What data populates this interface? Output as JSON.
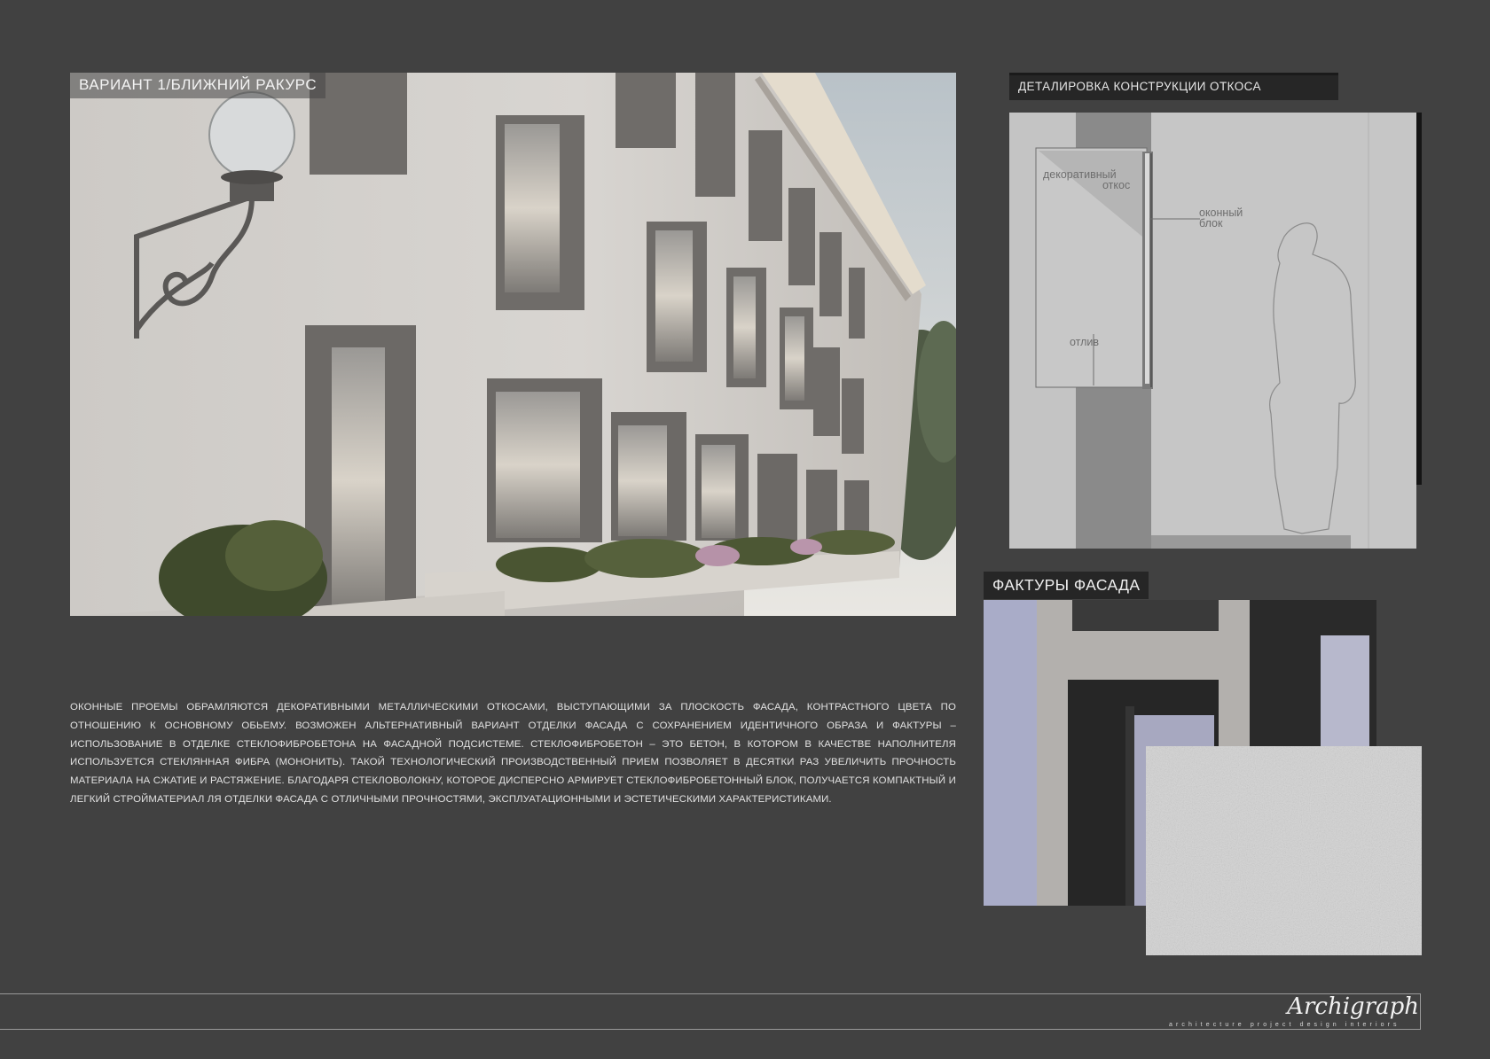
{
  "render": {
    "label": "ВАРИАНТ 1/БЛИЖНИЙ РАКУРС"
  },
  "detail": {
    "title": "ДЕТАЛИРОВКА КОНСТРУКЦИИ ОТКОСА",
    "labels": {
      "slope_line1": "декоративный",
      "slope_line2": "откос",
      "window_line1": "оконный",
      "window_line2": "блок",
      "drip": "отлив"
    }
  },
  "textures": {
    "title": "ФАКТУРЫ ФАСАДА"
  },
  "description": "Оконные проемы обрамляются декоративными металлическими откосами, выступающими за плоскость фасада, контрастного цвета по отношению к основному обьему. Возможен альтернативный вариант отделки фасада с сохранением идентичного образа и фактуры – использование в отделке стеклофибробетона на фасадной подсистеме. Стеклофибробетон – это бетон, в котором в качестве наполнителя используется стеклянная фибра (мононить). Такой технологический производственный прием позволяет в десятки раз увеличить прочность материала на сжатие и растяжение. Благодаря стекловолокну, которое дисперсно армирует стеклофибробетонный блок, получается компактный и легкий стройматериал ля отделки фасада с отличными прочностями, эксплуатационными и эстетическими характеристиками.",
  "footer": {
    "signature": "Archigraph",
    "tagline": "architecture project design interiors"
  },
  "colors": {
    "background": "#414141",
    "label_bg": "#262626",
    "drawing_bg": "#c4c4c4"
  }
}
